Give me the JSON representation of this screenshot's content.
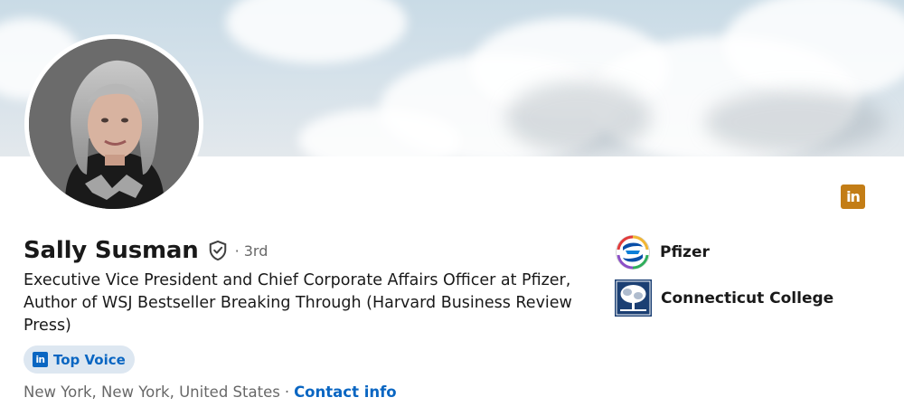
{
  "profile": {
    "name": "Sally Susman",
    "degree": "· 3rd",
    "headline": "Executive Vice President and Chief Corporate Affairs Officer at Pfizer, Author of WSJ Bestseller Breaking Through (Harvard Business Review Press)",
    "badge_label": "Top Voice",
    "badge_icon_text": "in",
    "location": "New York, New York, United States",
    "separator": "·",
    "contact_label": "Contact info"
  },
  "corner_badge": {
    "text": "in",
    "color": "#c37d16"
  },
  "organizations": [
    {
      "name": "Pfizer",
      "icon": "pfizer-logo"
    },
    {
      "name": "Connecticut College",
      "icon": "connecticut-college-logo"
    }
  ],
  "colors": {
    "link_blue": "#0a66c2",
    "badge_bg": "#dde7f1",
    "muted_text": "#666666"
  }
}
